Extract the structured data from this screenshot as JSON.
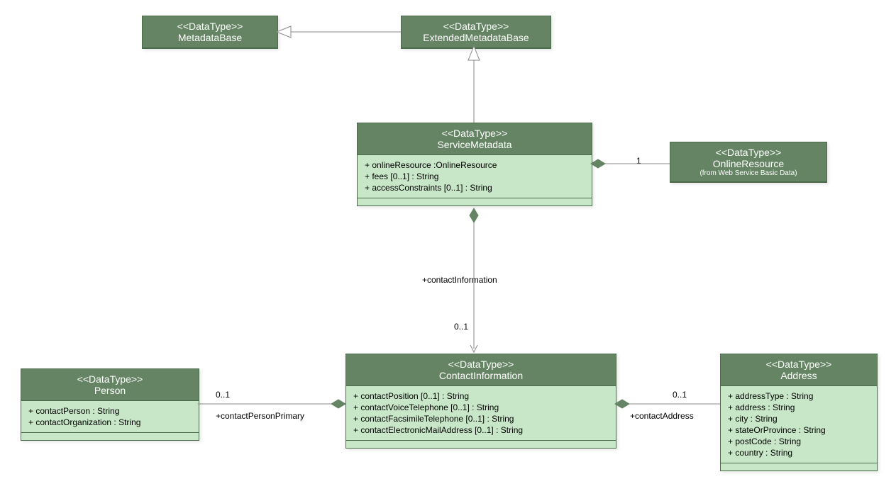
{
  "classes": {
    "metadataBase": {
      "stereotype": "<<DataType>>",
      "name": "MetadataBase"
    },
    "extendedMetadataBase": {
      "stereotype": "<<DataType>>",
      "name": "ExtendedMetadataBase"
    },
    "serviceMetadata": {
      "stereotype": "<<DataType>>",
      "name": "ServiceMetadata",
      "attributes": [
        "+ onlineResource :OnlineResource",
        "+ fees [0..1] : String",
        "+ accessConstraints [0..1] : String"
      ]
    },
    "onlineResource": {
      "stereotype": "<<DataType>>",
      "name": "OnlineResource",
      "subtitle": "(from Web Service Basic Data)"
    },
    "person": {
      "stereotype": "<<DataType>>",
      "name": "Person",
      "attributes": [
        "+ contactPerson : String",
        "+ contactOrganization : String"
      ]
    },
    "contactInformation": {
      "stereotype": "<<DataType>>",
      "name": "ContactInformation",
      "attributes": [
        "+ contactPosition [0..1] : String",
        "+ contactVoiceTelephone [0..1] : String",
        "+ contactFacsimileTelephone [0..1] : String",
        "+ contactElectronicMailAddress [0..1] : String"
      ]
    },
    "address": {
      "stereotype": "<<DataType>>",
      "name": "Address",
      "attributes": [
        "+ addressType : String",
        "+ address : String",
        "+ city : String",
        "+ stateOrProvince : String",
        "+ postCode : String",
        "+ country : String"
      ]
    }
  },
  "labels": {
    "contactInformation": "+contactInformation",
    "contactPersonPrimary": "+contactPersonPrimary",
    "contactAddress": "+contactAddress",
    "mult01_1": "0..1",
    "mult01_2": "0..1",
    "mult01_3": "0..1",
    "mult1": "1"
  }
}
